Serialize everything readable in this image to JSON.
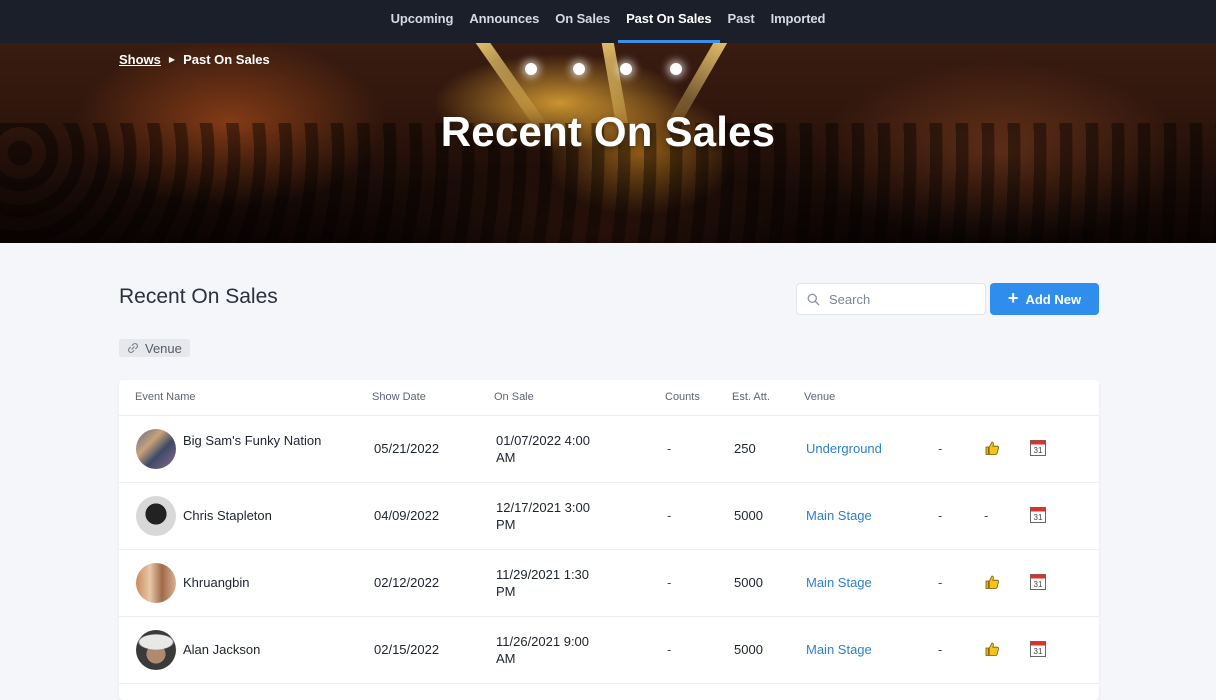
{
  "nav": {
    "tabs": [
      "Upcoming",
      "Announces",
      "On Sales",
      "Past On Sales",
      "Past",
      "Imported"
    ],
    "active": "Past On Sales"
  },
  "breadcrumb": {
    "root": "Shows",
    "current": "Past On Sales"
  },
  "hero": {
    "title": "Recent On Sales"
  },
  "page": {
    "title": "Recent On Sales",
    "search_placeholder": "Search",
    "add_label": "Add New",
    "filter_chip": "Venue"
  },
  "table": {
    "columns": {
      "event": "Event Name",
      "show_date": "Show Date",
      "on_sale": "On Sale",
      "counts": "Counts",
      "est_att": "Est. Att.",
      "venue": "Venue"
    },
    "rows": [
      {
        "event": "Big Sam's Funky Nation",
        "show_date": "05/21/2022",
        "on_sale_date": "01/07/2022 4:00",
        "on_sale_time": "AM",
        "counts": "-",
        "est_att": "250",
        "venue": "Underground",
        "extra": "-",
        "approved": "thumbs-up-icon",
        "approved_text": "",
        "calendar": "31"
      },
      {
        "event": "Chris Stapleton",
        "show_date": "04/09/2022",
        "on_sale_date": "12/17/2021 3:00",
        "on_sale_time": "PM",
        "counts": "-",
        "est_att": "5000",
        "venue": "Main Stage",
        "extra": "-",
        "approved": "none",
        "approved_text": "-",
        "calendar": "31"
      },
      {
        "event": "Khruangbin",
        "show_date": "02/12/2022",
        "on_sale_date": "11/29/2021 1:30",
        "on_sale_time": "PM",
        "counts": "-",
        "est_att": "5000",
        "venue": "Main Stage",
        "extra": "-",
        "approved": "thumbs-up-icon",
        "approved_text": "",
        "calendar": "31"
      },
      {
        "event": "Alan Jackson",
        "show_date": "02/15/2022",
        "on_sale_date": "11/26/2021 9:00",
        "on_sale_time": "AM",
        "counts": "-",
        "est_att": "5000",
        "venue": "Main Stage",
        "extra": "-",
        "approved": "thumbs-up-icon",
        "approved_text": "",
        "calendar": "31"
      }
    ]
  },
  "colors": {
    "nav_bg": "#1b1f2a",
    "accent": "#2f8eed",
    "link": "#2e7fcc",
    "active_underline": "#3b8fe8"
  }
}
